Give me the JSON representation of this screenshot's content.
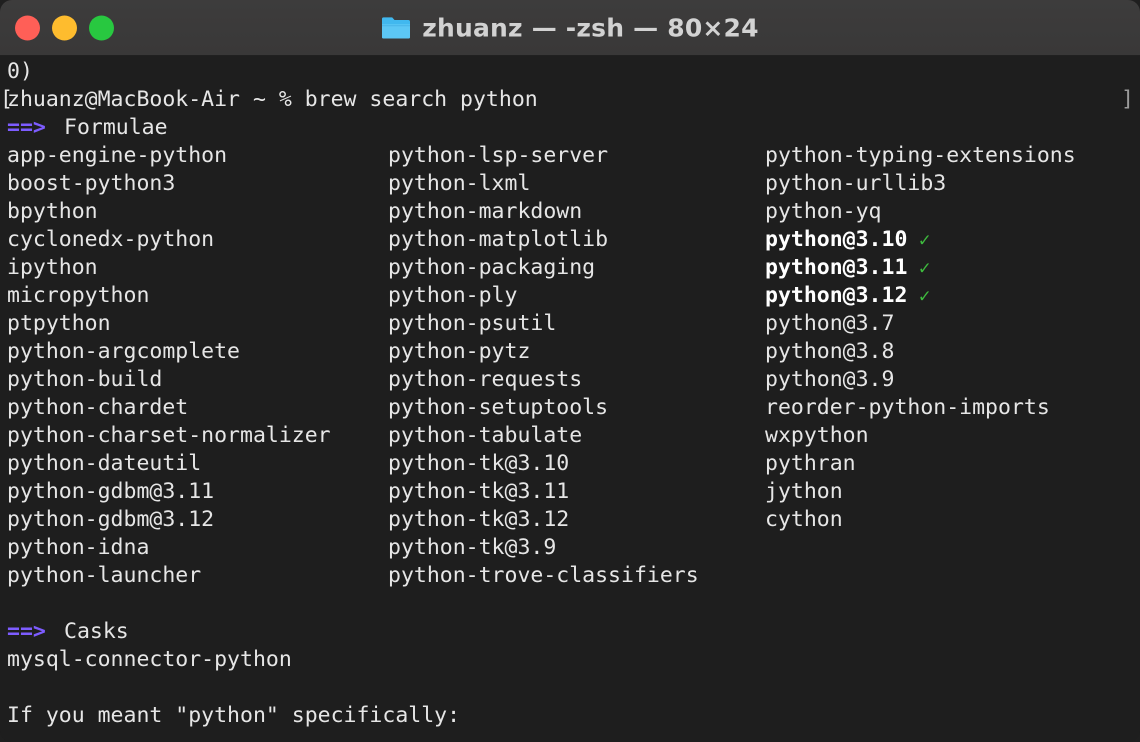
{
  "window": {
    "title": "zhuanz — -zsh — 80×24",
    "icon": "folder-icon",
    "traffic_lights": {
      "close_color": "#ff5f57",
      "minimize_color": "#febc2e",
      "maximize_color": "#28c840"
    },
    "titlebar_bg": "#3b3a3a",
    "terminal_bg": "#1e1e1e",
    "text_color": "#e6e6e6",
    "accent_arrow_color": "#7d5cff",
    "check_color": "#3ebb3e"
  },
  "terminal": {
    "scrollback_fragment": "0)",
    "prompt": {
      "leading_bracket": "[",
      "text": "zhuanz@MacBook-Air ~ % brew search python",
      "trailing_marker": "]"
    },
    "sections": [
      {
        "arrow": "==>",
        "heading": "Formulae"
      },
      {
        "arrow": "==>",
        "heading": "Casks"
      }
    ],
    "formulae_columns": [
      [
        "app-engine-python",
        "boost-python3",
        "bpython",
        "cyclonedx-python",
        "ipython",
        "micropython",
        "ptpython",
        "python-argcomplete",
        "python-build",
        "python-chardet",
        "python-charset-normalizer",
        "python-dateutil",
        "python-gdbm@3.11",
        "python-gdbm@3.12",
        "python-idna",
        "python-launcher"
      ],
      [
        "python-lsp-server",
        "python-lxml",
        "python-markdown",
        "python-matplotlib",
        "python-packaging",
        "python-ply",
        "python-psutil",
        "python-pytz",
        "python-requests",
        "python-setuptools",
        "python-tabulate",
        "python-tk@3.10",
        "python-tk@3.11",
        "python-tk@3.12",
        "python-tk@3.9",
        "python-trove-classifiers"
      ],
      [
        "python-typing-extensions",
        "python-urllib3",
        "python-yq",
        "python@3.10",
        "python@3.11",
        "python@3.12",
        "python@3.7",
        "python@3.8",
        "python@3.9",
        "reorder-python-imports",
        "wxpython",
        "pythran",
        "jython",
        "cython"
      ]
    ],
    "installed_flags": {
      "python@3.10": true,
      "python@3.11": true,
      "python@3.12": true
    },
    "check_glyph": "✓",
    "casks": [
      "mysql-connector-python"
    ],
    "footer_note": "If you meant \"python\" specifically:"
  }
}
